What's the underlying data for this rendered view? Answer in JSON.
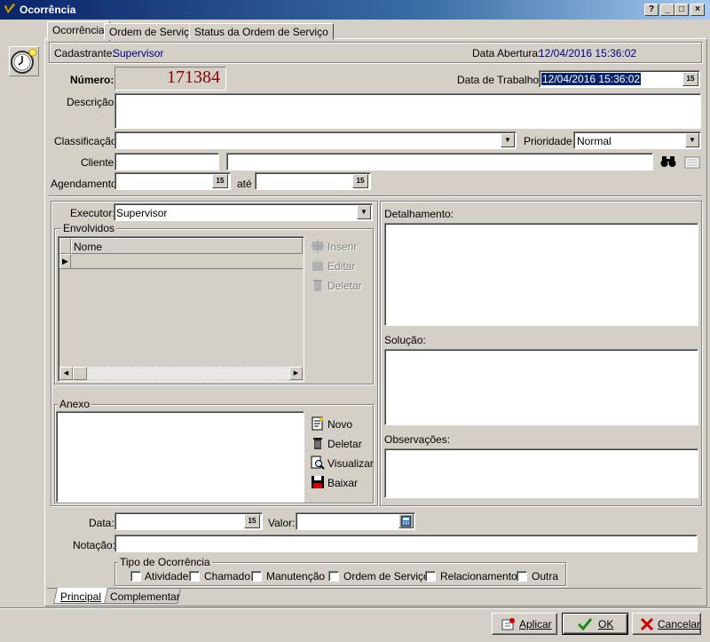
{
  "window": {
    "title": "Ocorrência",
    "buttons": {
      "help": "?",
      "minimize": "_",
      "maximize": "□",
      "close": "×"
    }
  },
  "tabs": [
    {
      "label": "Ocorrência",
      "active": true
    },
    {
      "label": "Ordem de Serviço",
      "active": false
    },
    {
      "label": "Status da Ordem de Serviço",
      "active": false
    }
  ],
  "info": {
    "cadastrante_label": "Cadastrante:",
    "cadastrante_value": "Supervisor",
    "data_abertura_label": "Data Abertura:",
    "data_abertura_value": "12/04/2016 15:36:02"
  },
  "form": {
    "numero_label": "Número:",
    "numero_value": "171384",
    "data_trabalho_label": "Data de Trabalho:",
    "data_trabalho_value": "12/04/2016 15:36:02",
    "descricao_label": "Descrição:",
    "descricao_value": "",
    "classificacao_label": "Classificação:",
    "classificacao_value": "",
    "prioridade_label": "Prioridade:",
    "prioridade_value": "Normal",
    "cliente_label": "Cliente:",
    "cliente_code": "",
    "cliente_name": "",
    "agendamento_label": "Agendamento:",
    "agendamento_from": "",
    "ate_label": "até",
    "agendamento_to": "",
    "calendar_glyph": "15"
  },
  "executor": {
    "label": "Executor:",
    "value": "Supervisor"
  },
  "envolvidos": {
    "title": "Envolvidos",
    "column_nome": "Nome",
    "actions": {
      "inserir": "Inserir",
      "editar": "Editar",
      "deletar": "Deletar"
    }
  },
  "anexo": {
    "title": "Anexo",
    "actions": {
      "novo": "Novo",
      "deletar": "Deletar",
      "visualizar": "Visualizar",
      "baixar": "Baixar"
    }
  },
  "detalhamento": {
    "label": "Detalhamento:"
  },
  "solucao": {
    "label": "Solução:"
  },
  "observacoes": {
    "label": "Observações:"
  },
  "bottom": {
    "data_label": "Data:",
    "data_value": "",
    "valor_label": "Valor:",
    "valor_value": "",
    "notacao_label": "Notação:",
    "notacao_value": ""
  },
  "tipo_ocorrencia": {
    "title": "Tipo de Ocorrência",
    "options": [
      {
        "label": "Atividade",
        "checked": false
      },
      {
        "label": "Chamado",
        "checked": false
      },
      {
        "label": "Manutenção",
        "checked": false
      },
      {
        "label": "Ordem de Serviço",
        "checked": false
      },
      {
        "label": "Relacionamento",
        "checked": false
      },
      {
        "label": "Outra",
        "checked": false
      }
    ]
  },
  "bottom_tabs": [
    {
      "label": "Principal",
      "active": true
    },
    {
      "label": "Complementar",
      "active": false
    }
  ],
  "footer": {
    "aplicar": "Aplicar",
    "ok": "OK",
    "cancelar": "Cancelar"
  },
  "colors": {
    "titlebar_start": "#0a246a",
    "face": "#d4d0c8",
    "link_blue": "#000080",
    "numero_red": "#8b0000",
    "selection": "#0a246a"
  }
}
